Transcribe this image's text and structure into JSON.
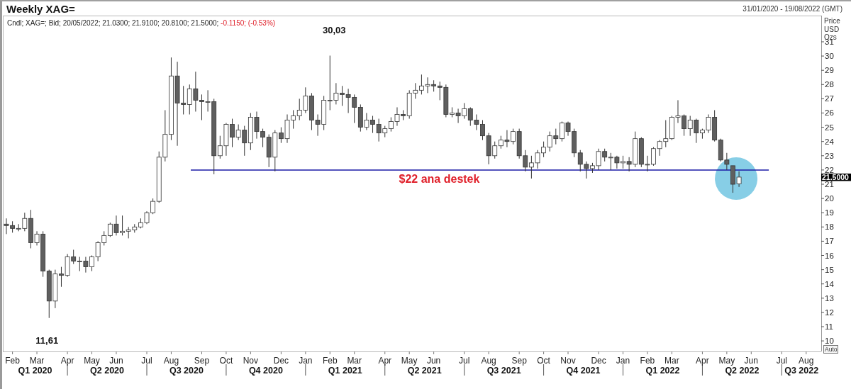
{
  "header": {
    "title": "Weekly XAG=",
    "date_range": "31/01/2020 - 19/08/2022 (GMT)"
  },
  "chart": {
    "info": [
      {
        "kind": "plain",
        "text": "Cndl; XAG=; Bid; 20/05/2022; 21.0300; 21.9100; 20.8100; 21.5000;"
      },
      {
        "kind": "change",
        "text": "-0.1150; (-0.53%)"
      }
    ],
    "axis_units": [
      "Price",
      "USD",
      "Ozs"
    ],
    "last_price": "21.5000",
    "auto_button": "Auto",
    "quarters": [
      "Q1 2020",
      "Q2 2020",
      "Q3 2020",
      "Q4 2020",
      "Q1 2021",
      "Q2 2021",
      "Q3 2021",
      "Q4 2021",
      "Q1 2022",
      "Q2 2022",
      "Q3 2022"
    ],
    "chart_data": {
      "type": "candlestick",
      "ylim": [
        9.26,
        32.84
      ],
      "yticks": [
        10,
        11,
        12,
        13,
        14,
        15,
        16,
        17,
        18,
        19,
        20,
        21,
        22,
        23,
        24,
        25,
        26,
        27,
        28,
        29,
        30,
        31
      ],
      "categories": [
        null,
        "Feb",
        null,
        null,
        null,
        "Mar",
        null,
        null,
        null,
        null,
        "Apr",
        null,
        null,
        null,
        "May",
        null,
        null,
        null,
        "Jun",
        null,
        null,
        null,
        null,
        "Jul",
        null,
        null,
        null,
        "Aug",
        null,
        null,
        null,
        null,
        "Sep",
        null,
        null,
        null,
        "Oct",
        null,
        null,
        null,
        "Nov",
        null,
        null,
        null,
        null,
        "Dec",
        null,
        null,
        null,
        "Jan",
        null,
        null,
        null,
        "Feb",
        null,
        null,
        null,
        "Mar",
        null,
        null,
        null,
        null,
        "Apr",
        null,
        null,
        null,
        "May",
        null,
        null,
        null,
        "Jun",
        null,
        null,
        null,
        null,
        "Jul",
        null,
        null,
        null,
        "Aug",
        null,
        null,
        null,
        null,
        "Sep",
        null,
        null,
        null,
        "Oct",
        null,
        null,
        null,
        "Nov",
        null,
        null,
        null,
        null,
        "Dec",
        null,
        null,
        null,
        "Jan",
        null,
        null,
        null,
        "Feb",
        null,
        null,
        null,
        "Mar",
        null,
        null,
        null,
        null,
        "Apr",
        null,
        null,
        null,
        "May",
        null,
        null,
        null,
        "Jun",
        null,
        null,
        null,
        null,
        "Jul",
        null,
        null,
        null,
        "Aug",
        null,
        null
      ],
      "ohlc": [
        [
          18.2,
          18.6,
          17.5,
          18.1
        ],
        [
          18.1,
          18.4,
          17.6,
          17.9
        ],
        [
          17.9,
          18.2,
          17.7,
          17.9
        ],
        [
          17.9,
          19.0,
          17.7,
          18.6
        ],
        [
          18.6,
          19.2,
          16.5,
          16.9
        ],
        [
          16.9,
          17.7,
          16.7,
          17.5
        ],
        [
          17.5,
          17.7,
          14.5,
          14.9
        ],
        [
          14.9,
          15.0,
          11.61,
          12.8
        ],
        [
          12.8,
          15.0,
          12.3,
          14.7
        ],
        [
          14.7,
          15.2,
          13.8,
          14.6
        ],
        [
          14.6,
          16.1,
          14.5,
          15.9
        ],
        [
          15.9,
          16.4,
          15.4,
          15.6
        ],
        [
          15.6,
          15.9,
          14.9,
          15.6
        ],
        [
          15.6,
          15.9,
          14.8,
          15.2
        ],
        [
          15.2,
          16.0,
          14.9,
          15.9
        ],
        [
          15.9,
          17.0,
          15.6,
          16.9
        ],
        [
          16.9,
          17.7,
          16.7,
          17.4
        ],
        [
          17.4,
          18.3,
          17.3,
          18.2
        ],
        [
          18.2,
          18.8,
          17.4,
          17.6
        ],
        [
          17.6,
          18.8,
          17.4,
          17.7
        ],
        [
          17.7,
          18.0,
          17.2,
          17.8
        ],
        [
          17.8,
          18.2,
          17.6,
          18.0
        ],
        [
          18.0,
          18.6,
          17.9,
          18.3
        ],
        [
          18.3,
          19.1,
          18.2,
          19.0
        ],
        [
          19.0,
          20.0,
          18.9,
          19.8
        ],
        [
          19.8,
          23.3,
          19.7,
          22.9
        ],
        [
          22.9,
          26.2,
          22.6,
          24.5
        ],
        [
          24.5,
          29.9,
          24.1,
          28.6
        ],
        [
          28.6,
          29.6,
          23.7,
          26.7
        ],
        [
          26.7,
          27.9,
          25.9,
          26.6
        ],
        [
          26.6,
          28.0,
          25.9,
          27.7
        ],
        [
          27.7,
          28.9,
          26.1,
          26.9
        ],
        [
          26.9,
          27.3,
          25.5,
          26.8
        ],
        [
          26.8,
          27.6,
          26.1,
          26.8
        ],
        [
          26.8,
          27.0,
          21.7,
          23.0
        ],
        [
          23.0,
          24.4,
          22.8,
          23.7
        ],
        [
          23.7,
          25.3,
          23.0,
          25.2
        ],
        [
          25.2,
          25.6,
          23.6,
          24.3
        ],
        [
          24.3,
          25.2,
          24.1,
          24.8
        ],
        [
          24.8,
          25.1,
          23.0,
          23.9
        ],
        [
          23.9,
          26.0,
          23.4,
          25.7
        ],
        [
          25.7,
          26.1,
          24.2,
          24.7
        ],
        [
          24.7,
          24.9,
          23.6,
          24.3
        ],
        [
          24.3,
          24.5,
          22.2,
          22.9
        ],
        [
          22.9,
          24.8,
          21.9,
          24.6
        ],
        [
          24.6,
          25.0,
          23.9,
          24.2
        ],
        [
          24.2,
          25.9,
          23.9,
          25.5
        ],
        [
          25.5,
          26.2,
          24.9,
          25.8
        ],
        [
          25.8,
          27.0,
          25.5,
          26.2
        ],
        [
          26.2,
          27.8,
          26.0,
          27.2
        ],
        [
          27.2,
          27.4,
          24.8,
          25.5
        ],
        [
          25.5,
          25.9,
          24.4,
          25.2
        ],
        [
          25.2,
          27.2,
          24.8,
          26.9
        ],
        [
          26.9,
          30.03,
          26.2,
          26.9
        ],
        [
          26.9,
          28.1,
          26.6,
          27.4
        ],
        [
          27.4,
          27.9,
          26.5,
          27.3
        ],
        [
          27.3,
          27.7,
          26.0,
          27.1
        ],
        [
          27.1,
          27.3,
          25.3,
          26.4
        ],
        [
          26.4,
          26.6,
          24.7,
          25.0
        ],
        [
          25.0,
          26.0,
          24.8,
          25.5
        ],
        [
          25.5,
          25.8,
          24.6,
          25.2
        ],
        [
          25.2,
          25.6,
          24.0,
          24.6
        ],
        [
          24.6,
          25.1,
          24.3,
          24.9
        ],
        [
          24.9,
          25.7,
          24.7,
          25.4
        ],
        [
          25.4,
          26.4,
          25.1,
          25.9
        ],
        [
          25.9,
          26.2,
          25.5,
          25.8
        ],
        [
          25.8,
          27.6,
          25.6,
          27.4
        ],
        [
          27.4,
          28.1,
          27.0,
          27.6
        ],
        [
          27.6,
          28.7,
          27.3,
          27.9
        ],
        [
          27.9,
          28.5,
          27.4,
          28.0
        ],
        [
          28.0,
          28.3,
          27.5,
          27.9
        ],
        [
          27.9,
          28.2,
          26.9,
          27.8
        ],
        [
          27.8,
          28.0,
          25.7,
          25.9
        ],
        [
          25.9,
          26.4,
          25.7,
          26.0
        ],
        [
          26.0,
          26.3,
          25.3,
          25.8
        ],
        [
          25.8,
          26.7,
          25.6,
          26.3
        ],
        [
          26.3,
          26.4,
          25.1,
          25.5
        ],
        [
          25.5,
          25.9,
          24.8,
          25.2
        ],
        [
          25.2,
          25.5,
          24.1,
          24.4
        ],
        [
          24.4,
          24.6,
          22.4,
          23.0
        ],
        [
          23.0,
          24.0,
          22.8,
          23.7
        ],
        [
          23.7,
          24.4,
          23.5,
          24.1
        ],
        [
          24.1,
          24.8,
          23.6,
          24.0
        ],
        [
          24.0,
          24.9,
          23.8,
          24.7
        ],
        [
          24.7,
          24.9,
          22.8,
          23.0
        ],
        [
          23.0,
          23.4,
          21.9,
          22.2
        ],
        [
          22.2,
          23.0,
          21.4,
          22.5
        ],
        [
          22.5,
          23.4,
          22.1,
          23.2
        ],
        [
          23.2,
          24.0,
          22.9,
          23.6
        ],
        [
          23.6,
          24.7,
          23.3,
          24.4
        ],
        [
          24.4,
          24.9,
          23.8,
          24.2
        ],
        [
          24.2,
          25.4,
          24.0,
          25.3
        ],
        [
          25.3,
          25.4,
          24.4,
          24.7
        ],
        [
          24.7,
          24.9,
          22.9,
          23.2
        ],
        [
          23.2,
          23.4,
          21.9,
          22.4
        ],
        [
          22.4,
          22.6,
          21.4,
          22.1
        ],
        [
          22.1,
          22.5,
          21.8,
          22.3
        ],
        [
          22.3,
          23.5,
          22.0,
          23.3
        ],
        [
          23.3,
          23.5,
          22.6,
          22.9
        ],
        [
          22.9,
          23.2,
          22.0,
          22.9
        ],
        [
          22.9,
          23.0,
          22.1,
          22.5
        ],
        [
          22.5,
          23.0,
          22.1,
          22.6
        ],
        [
          22.6,
          22.9,
          21.9,
          22.4
        ],
        [
          22.4,
          24.7,
          22.2,
          24.2
        ],
        [
          24.2,
          24.3,
          22.2,
          22.4
        ],
        [
          22.4,
          23.0,
          21.9,
          22.4
        ],
        [
          22.4,
          23.6,
          22.3,
          23.5
        ],
        [
          23.5,
          24.1,
          23.0,
          24.0
        ],
        [
          24.0,
          25.5,
          23.6,
          24.2
        ],
        [
          24.2,
          25.8,
          24.1,
          25.7
        ],
        [
          25.7,
          26.9,
          25.3,
          25.8
        ],
        [
          25.8,
          25.9,
          24.4,
          24.9
        ],
        [
          24.9,
          25.8,
          24.4,
          25.5
        ],
        [
          25.5,
          25.6,
          23.9,
          24.6
        ],
        [
          24.6,
          24.9,
          24.2,
          24.8
        ],
        [
          24.8,
          25.9,
          24.6,
          25.7
        ],
        [
          25.7,
          26.2,
          24.0,
          24.1
        ],
        [
          24.1,
          24.2,
          22.6,
          22.7
        ],
        [
          22.7,
          23.2,
          22.0,
          22.4
        ],
        [
          22.3,
          22.3,
          20.4,
          21.0
        ],
        [
          21.03,
          21.91,
          20.81,
          21.5
        ],
        null,
        null,
        null,
        null,
        null,
        null,
        null,
        null,
        null,
        null,
        null,
        null,
        null
      ],
      "ref_lines": [
        {
          "axis": "y",
          "value": 22,
          "label": "$22 ana destek"
        }
      ],
      "annotations": [
        "30,03",
        "11,61"
      ]
    }
  }
}
